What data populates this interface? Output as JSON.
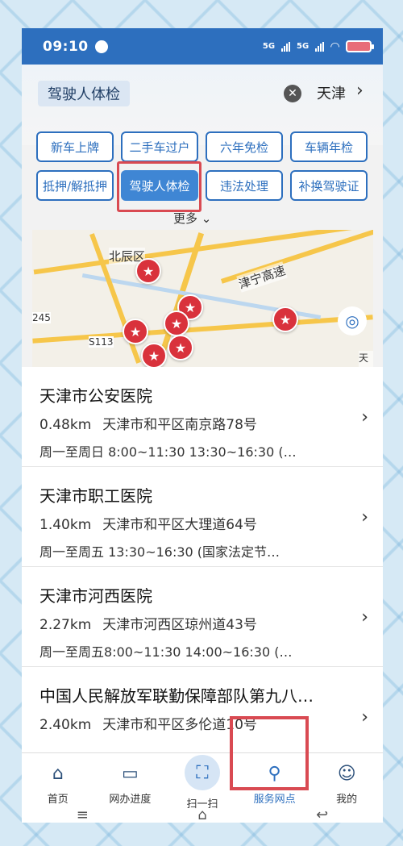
{
  "status_bar": {
    "time": "09:10",
    "signal_1": "5G",
    "signal_2": "5G"
  },
  "search": {
    "query": "驾驶人体检",
    "city": "天津"
  },
  "categories": [
    [
      "新车上牌",
      "二手车过户",
      "六年免检",
      "车辆年检"
    ],
    [
      "抵押/解抵押",
      "驾驶人体检",
      "违法处理",
      "补换驾驶证"
    ]
  ],
  "active_category": "驾驶人体检",
  "more_label": "更多",
  "map": {
    "labels": [
      "北辰区",
      "津宁高速",
      "S113",
      "245",
      "天津"
    ]
  },
  "hospitals": [
    {
      "name": "天津市公安医院",
      "distance": "0.48km",
      "address": "天津市和平区南京路78号",
      "hours": "周一至周日 8:00~11:30 13:30~16:30 (…"
    },
    {
      "name": "天津市职工医院",
      "distance": "1.40km",
      "address": "天津市和平区大理道64号",
      "hours": "周一至周五  13:30~16:30 (国家法定节…"
    },
    {
      "name": "天津市河西医院",
      "distance": "2.27km",
      "address": "天津市河西区琼州道43号",
      "hours": "周一至周五8:00~11:30  14:00~16:30 (…"
    },
    {
      "name": "中国人民解放军联勤保障部队第九八…",
      "distance": "2.40km",
      "address": "天津市和平区多伦道10号",
      "hours": ""
    }
  ],
  "tabs": [
    {
      "label": "首页",
      "icon": "home-icon"
    },
    {
      "label": "网办进度",
      "icon": "monitor-icon"
    },
    {
      "label": "扫一扫",
      "icon": "scan-icon"
    },
    {
      "label": "服务网点",
      "icon": "map-pin-icon"
    },
    {
      "label": "我的",
      "icon": "user-icon"
    }
  ],
  "colors": {
    "primary": "#2d6fbe",
    "highlight": "#d94a52",
    "pin": "#d9323c"
  }
}
